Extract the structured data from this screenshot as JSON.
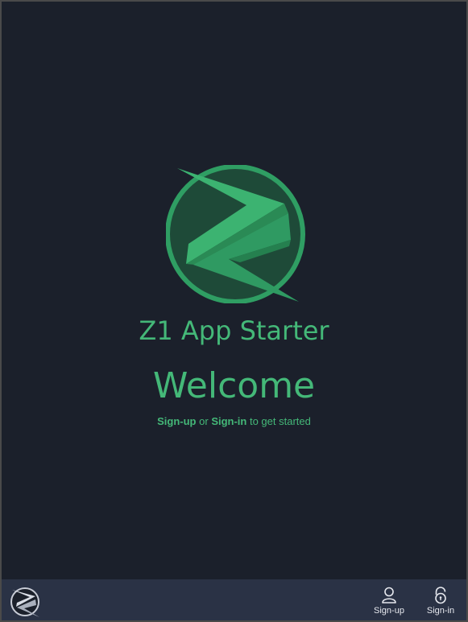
{
  "app": {
    "title": "Z1 App Starter"
  },
  "hero": {
    "heading": "Welcome",
    "signup_link": "Sign-up",
    "or_text": " or ",
    "signin_link": "Sign-in",
    "suffix_text": " to get started"
  },
  "bottom_nav": {
    "brand_icon": "z1-logo-icon",
    "items": [
      {
        "label": "Sign-up",
        "icon": "user-icon"
      },
      {
        "label": "Sign-in",
        "icon": "unlock-icon"
      }
    ]
  },
  "colors": {
    "background": "#1b202b",
    "bottom_bar": "#2a3245",
    "accent": "#44b878",
    "logo_circle": "#1e4a38",
    "nav_text": "#e6e8ee"
  }
}
